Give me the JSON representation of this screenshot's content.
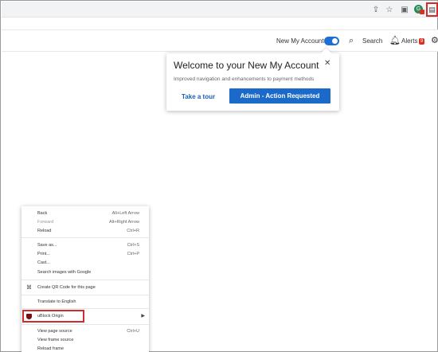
{
  "browser": {
    "share_icon": "share-icon",
    "star_icon": "star-icon",
    "extension_icon": "puzzle-icon",
    "profile_badge": "G",
    "highlighted_extension_icon": "ublock-extension-icon"
  },
  "header": {
    "toggle_label": "New My Account",
    "toggle_on": true,
    "search_label": "Search",
    "alerts_label": "Alerts",
    "alerts_count": "9"
  },
  "popover": {
    "title": "Welcome to your New My Account",
    "subtitle": "Improved navigation and enhancements to payment methods",
    "close": "✕",
    "tour_link": "Take a tour",
    "action_button": "Admin - Action Requested"
  },
  "context_menu": {
    "items": [
      {
        "label": "Back",
        "shortcut": "Alt+Left Arrow"
      },
      {
        "label": "Forward",
        "shortcut": "Alt+Right Arrow",
        "disabled": true
      },
      {
        "label": "Reload",
        "shortcut": "Ctrl+R"
      },
      {
        "label": "Save as...",
        "shortcut": "Ctrl+S"
      },
      {
        "label": "Print...",
        "shortcut": "Ctrl+P"
      },
      {
        "label": "Cast...",
        "shortcut": ""
      },
      {
        "label": "Search images with Google",
        "shortcut": ""
      },
      {
        "label": "Create QR Code for this page",
        "shortcut": ""
      },
      {
        "label": "Translate to English",
        "shortcut": ""
      },
      {
        "label": "uBlock Origin",
        "shortcut": ""
      },
      {
        "label": "View page source",
        "shortcut": "Ctrl+U"
      },
      {
        "label": "View frame source",
        "shortcut": ""
      },
      {
        "label": "Reload frame",
        "shortcut": ""
      }
    ]
  },
  "colors": {
    "accent": "#1b6ac9",
    "highlight": "#d12b2b",
    "badge": "#d93025"
  }
}
